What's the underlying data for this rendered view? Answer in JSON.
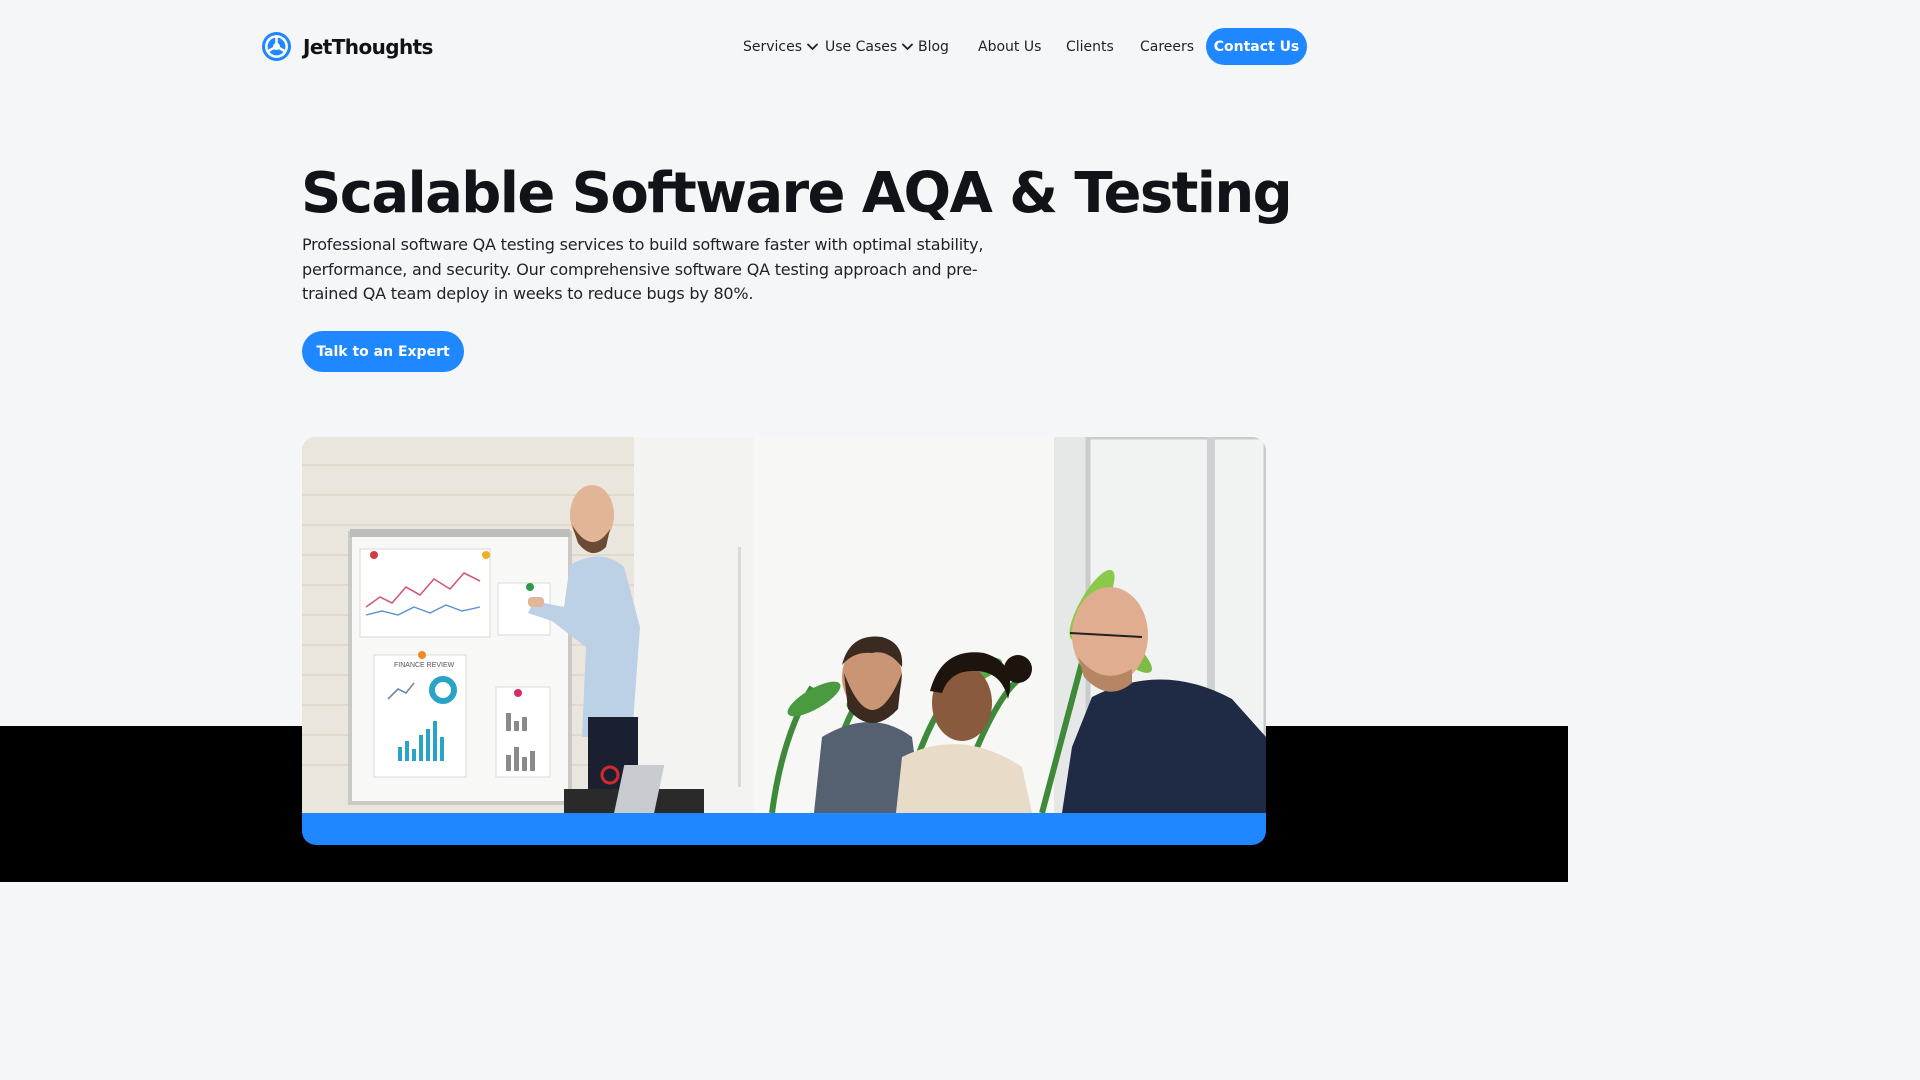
{
  "brand": {
    "name": "JetThoughts",
    "accent": "#1f87ff"
  },
  "nav": {
    "items": [
      {
        "label": "Services",
        "dropdown": true
      },
      {
        "label": "Use Cases",
        "dropdown": true
      },
      {
        "label": "Blog",
        "dropdown": false
      },
      {
        "label": "About Us",
        "dropdown": false
      },
      {
        "label": "Clients",
        "dropdown": false
      },
      {
        "label": "Careers",
        "dropdown": false
      }
    ],
    "contact_label": "Contact Us"
  },
  "hero": {
    "title": "Scalable Software AQA & Testing",
    "description": "Professional software QA testing services to build software faster with optimal stability, performance, and security. Our comprehensive software QA testing approach and pre-trained QA team deploy in weeks to reduce bugs by 80%.",
    "cta_label": "Talk to an Expert"
  },
  "photo": {
    "board_label": "FINANCE REVIEW"
  }
}
